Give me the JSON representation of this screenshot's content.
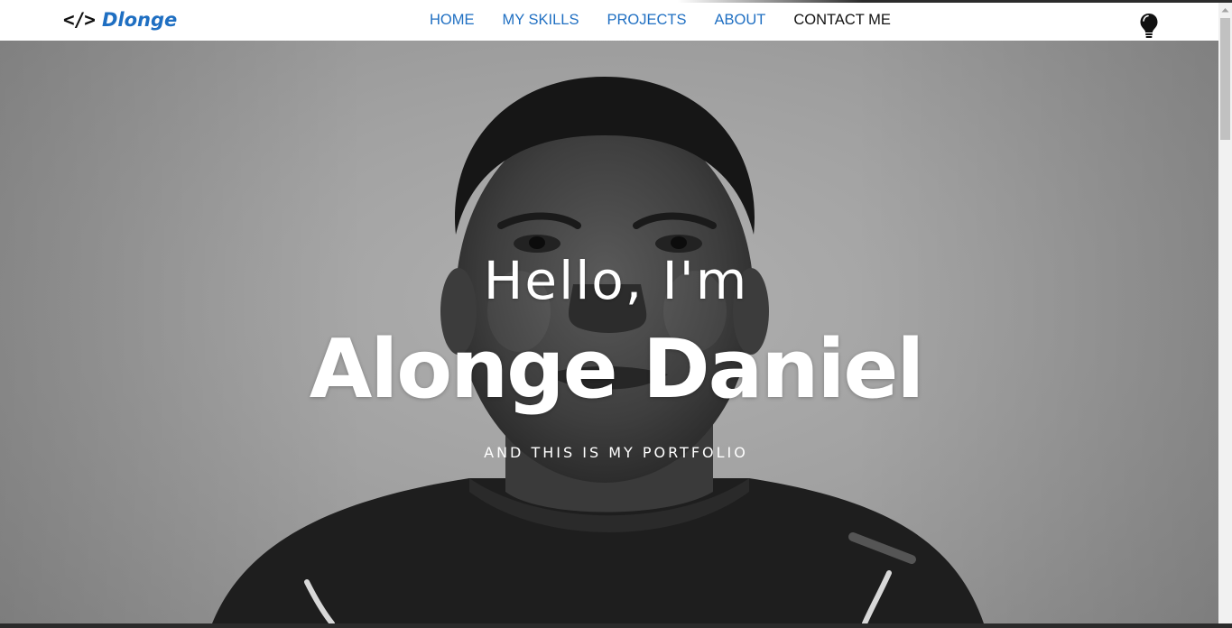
{
  "brand": {
    "icon_text": "</>",
    "name": "Dlonge"
  },
  "nav": {
    "items": [
      {
        "label": "HOME"
      },
      {
        "label": "MY SKILLS"
      },
      {
        "label": "PROJECTS"
      },
      {
        "label": "ABOUT"
      },
      {
        "label": "CONTACT ME"
      }
    ],
    "theme_toggle_icon": "lightbulb-icon"
  },
  "hero": {
    "greeting": "Hello, I'm",
    "name": "Alonge Daniel",
    "tagline": "AND THIS IS MY PORTFOLIO",
    "background_image": "grayscale-portrait"
  },
  "colors": {
    "brand_blue": "#1f6fc2",
    "active_nav": "#111111",
    "hero_text": "#ffffff"
  }
}
